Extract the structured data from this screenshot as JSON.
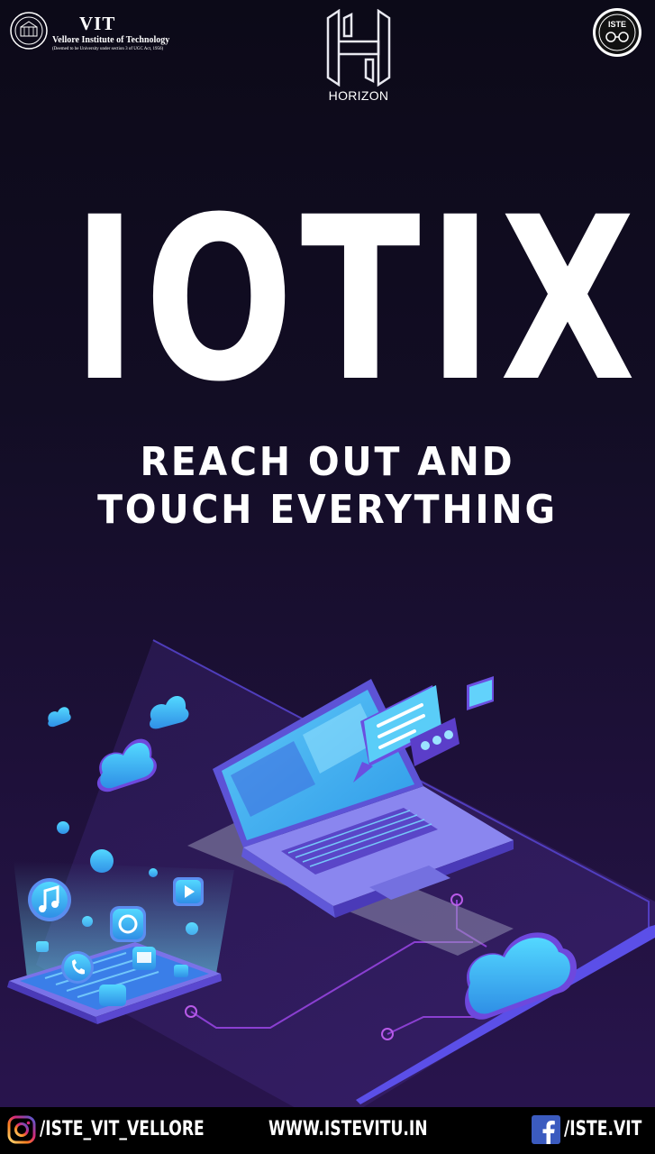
{
  "header": {
    "vit": {
      "name": "VIT",
      "full_name": "Vellore Institute of Technology",
      "deemed": "(Deemed to be University under section 3 of UGC Act, 1956)"
    },
    "horizon": {
      "name": "HORIZON"
    },
    "iste": {
      "name": "ISTE"
    }
  },
  "title": "IOTIX",
  "subtitle_line1": "REACH OUT AND",
  "subtitle_line2": "TOUCH EVERYTHING",
  "footer": {
    "instagram": "/ISTE_VIT_VELLORE",
    "website": "WWW.ISTEVITU.IN",
    "facebook": "/ISTE.VIT"
  },
  "colors": {
    "background_top": "#0c0a18",
    "background_bottom": "#2a1550",
    "accent_cyan": "#3fc3f5",
    "accent_violet": "#6a4cf0",
    "footer_bg": "#000000"
  },
  "icons": [
    "instagram-icon",
    "facebook-icon",
    "music-icon",
    "phone-icon",
    "play-icon",
    "cloud-icon",
    "chat-icon"
  ]
}
